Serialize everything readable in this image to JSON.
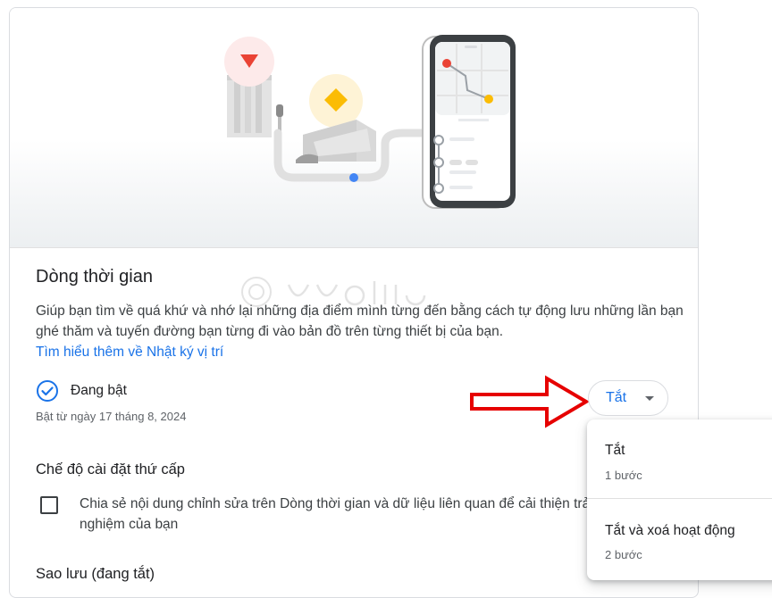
{
  "timeline": {
    "title": "Dòng thời gian",
    "description": "Giúp bạn tìm về quá khứ và nhớ lại những địa điểm mình từng đến bằng cách tự động lưu những lần bạn ghé thăm và tuyến đường bạn từng đi vào bản đồ trên từng thiết bị của bạn.",
    "learn_more_link": "Tìm hiểu thêm về Nhật ký vị trí",
    "status_label": "Đang bật",
    "status_since": "Bật từ ngày 17 tháng 8, 2024"
  },
  "secondary": {
    "title": "Chế độ cài đặt thứ cấp",
    "checkbox_label": "Chia sẻ nội dung chỉnh sửa trên Dòng thời gian và dữ liệu liên quan để cải thiện trải nghiệm của bạn",
    "checkbox_checked": false
  },
  "backup": {
    "title": "Sao lưu (đang tắt)"
  },
  "turn_off_button": {
    "label": "Tắt",
    "icon": "caret-down-icon"
  },
  "dropdown_menu": {
    "items": [
      {
        "title": "Tắt",
        "subtitle": "1 bước"
      },
      {
        "title": "Tắt và xoá hoạt động",
        "subtitle": "2 bước"
      }
    ]
  },
  "colors": {
    "accent_blue": "#1a73e8",
    "annotation_red": "#e60000",
    "pin_red": "#ea4335",
    "pin_yellow": "#fbbc04"
  }
}
